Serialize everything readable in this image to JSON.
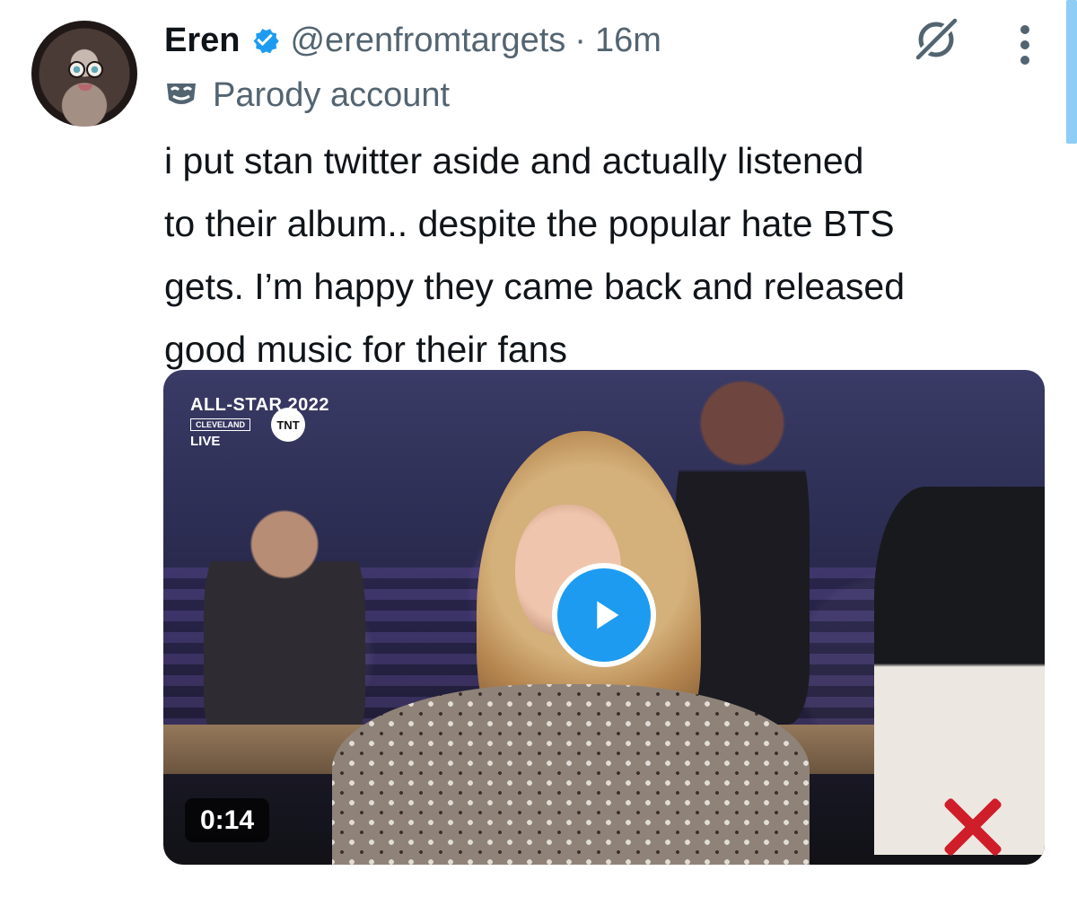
{
  "author": {
    "display_name": "Eren",
    "handle": "@erenfromtargets",
    "separator": "·",
    "time": "16m"
  },
  "account_label": "Parody account",
  "tweet": {
    "lines": [
      "i put stan twitter aside and actually listened",
      "to their album.. despite the popular hate BTS",
      "gets. I’m happy they came back and released",
      "good music for their fans"
    ]
  },
  "video": {
    "duration": "0:14",
    "overlay": {
      "event": "ALL-STAR 2022",
      "city": "CLEVELAND",
      "status": "LIVE",
      "network": "TNT"
    }
  },
  "icons": {
    "verified": "verified-badge-icon",
    "grok": "grok-icon",
    "more": "more-icon",
    "parody": "parody-mask-icon",
    "play": "play-icon"
  },
  "colors": {
    "brand": "#1d9bf0",
    "text": "#0f1419",
    "secondary": "#536471"
  }
}
